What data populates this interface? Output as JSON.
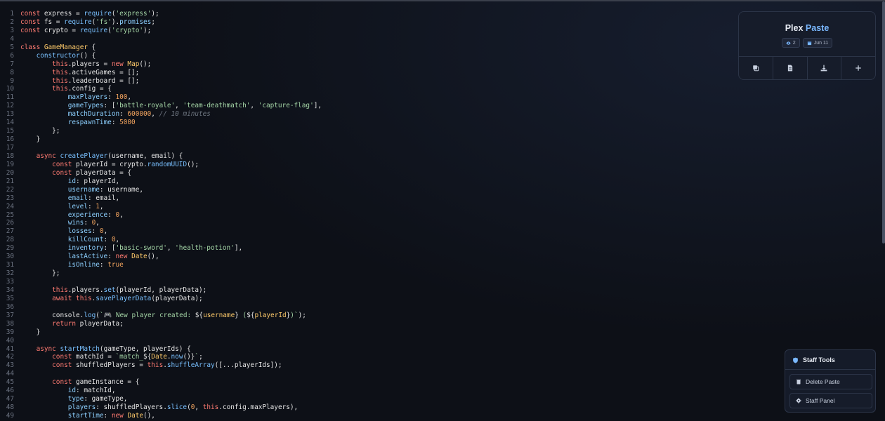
{
  "code_lines": [
    [
      [
        "k",
        "const"
      ],
      [
        "p",
        " express = "
      ],
      [
        "f",
        "require"
      ],
      [
        "p",
        "("
      ],
      [
        "s",
        "'express'"
      ],
      [
        "p",
        ");"
      ]
    ],
    [
      [
        "k",
        "const"
      ],
      [
        "p",
        " fs = "
      ],
      [
        "f",
        "require"
      ],
      [
        "p",
        "("
      ],
      [
        "s",
        "'fs'"
      ],
      [
        "p",
        ")."
      ],
      [
        "pr",
        "promises"
      ],
      [
        "p",
        ";"
      ]
    ],
    [
      [
        "k",
        "const"
      ],
      [
        "p",
        " crypto = "
      ],
      [
        "f",
        "require"
      ],
      [
        "p",
        "("
      ],
      [
        "s",
        "'crypto'"
      ],
      [
        "p",
        ");"
      ]
    ],
    [],
    [
      [
        "k",
        "class"
      ],
      [
        "p",
        " "
      ],
      [
        "cl",
        "GameManager"
      ],
      [
        "p",
        " {"
      ]
    ],
    [
      [
        "p",
        "    "
      ],
      [
        "f",
        "constructor"
      ],
      [
        "p",
        "() {"
      ]
    ],
    [
      [
        "p",
        "        "
      ],
      [
        "k",
        "this"
      ],
      [
        "p",
        ".players = "
      ],
      [
        "k",
        "new"
      ],
      [
        "p",
        " "
      ],
      [
        "cl",
        "Map"
      ],
      [
        "p",
        "();"
      ]
    ],
    [
      [
        "p",
        "        "
      ],
      [
        "k",
        "this"
      ],
      [
        "p",
        ".activeGames = [];"
      ]
    ],
    [
      [
        "p",
        "        "
      ],
      [
        "k",
        "this"
      ],
      [
        "p",
        ".leaderboard = [];"
      ]
    ],
    [
      [
        "p",
        "        "
      ],
      [
        "k",
        "this"
      ],
      [
        "p",
        ".config = {"
      ]
    ],
    [
      [
        "p",
        "            "
      ],
      [
        "pr",
        "maxPlayers"
      ],
      [
        "p",
        ": "
      ],
      [
        "n",
        "100"
      ],
      [
        "p",
        ","
      ]
    ],
    [
      [
        "p",
        "            "
      ],
      [
        "pr",
        "gameTypes"
      ],
      [
        "p",
        ": ["
      ],
      [
        "s",
        "'battle-royale'"
      ],
      [
        "p",
        ", "
      ],
      [
        "s",
        "'team-deathmatch'"
      ],
      [
        "p",
        ", "
      ],
      [
        "s",
        "'capture-flag'"
      ],
      [
        "p",
        "],"
      ]
    ],
    [
      [
        "p",
        "            "
      ],
      [
        "pr",
        "matchDuration"
      ],
      [
        "p",
        ": "
      ],
      [
        "n",
        "600000"
      ],
      [
        "p",
        ", "
      ],
      [
        "c",
        "// 10 minutes"
      ]
    ],
    [
      [
        "p",
        "            "
      ],
      [
        "pr",
        "respawnTime"
      ],
      [
        "p",
        ": "
      ],
      [
        "n",
        "5000"
      ]
    ],
    [
      [
        "p",
        "        };"
      ]
    ],
    [
      [
        "p",
        "    }"
      ]
    ],
    [],
    [
      [
        "p",
        "    "
      ],
      [
        "k",
        "async"
      ],
      [
        "p",
        " "
      ],
      [
        "f",
        "createPlayer"
      ],
      [
        "p",
        "(username, email) {"
      ]
    ],
    [
      [
        "p",
        "        "
      ],
      [
        "k",
        "const"
      ],
      [
        "p",
        " playerId = crypto."
      ],
      [
        "f",
        "randomUUID"
      ],
      [
        "p",
        "();"
      ]
    ],
    [
      [
        "p",
        "        "
      ],
      [
        "k",
        "const"
      ],
      [
        "p",
        " playerData = {"
      ]
    ],
    [
      [
        "p",
        "            "
      ],
      [
        "pr",
        "id"
      ],
      [
        "p",
        ": playerId,"
      ]
    ],
    [
      [
        "p",
        "            "
      ],
      [
        "pr",
        "username"
      ],
      [
        "p",
        ": username,"
      ]
    ],
    [
      [
        "p",
        "            "
      ],
      [
        "pr",
        "email"
      ],
      [
        "p",
        ": email,"
      ]
    ],
    [
      [
        "p",
        "            "
      ],
      [
        "pr",
        "level"
      ],
      [
        "p",
        ": "
      ],
      [
        "n",
        "1"
      ],
      [
        "p",
        ","
      ]
    ],
    [
      [
        "p",
        "            "
      ],
      [
        "pr",
        "experience"
      ],
      [
        "p",
        ": "
      ],
      [
        "n",
        "0"
      ],
      [
        "p",
        ","
      ]
    ],
    [
      [
        "p",
        "            "
      ],
      [
        "pr",
        "wins"
      ],
      [
        "p",
        ": "
      ],
      [
        "n",
        "0"
      ],
      [
        "p",
        ","
      ]
    ],
    [
      [
        "p",
        "            "
      ],
      [
        "pr",
        "losses"
      ],
      [
        "p",
        ": "
      ],
      [
        "n",
        "0"
      ],
      [
        "p",
        ","
      ]
    ],
    [
      [
        "p",
        "            "
      ],
      [
        "pr",
        "killCount"
      ],
      [
        "p",
        ": "
      ],
      [
        "n",
        "0"
      ],
      [
        "p",
        ","
      ]
    ],
    [
      [
        "p",
        "            "
      ],
      [
        "pr",
        "inventory"
      ],
      [
        "p",
        ": ["
      ],
      [
        "s",
        "'basic-sword'"
      ],
      [
        "p",
        ", "
      ],
      [
        "s",
        "'health-potion'"
      ],
      [
        "p",
        "],"
      ]
    ],
    [
      [
        "p",
        "            "
      ],
      [
        "pr",
        "lastActive"
      ],
      [
        "p",
        ": "
      ],
      [
        "k",
        "new"
      ],
      [
        "p",
        " "
      ],
      [
        "cl",
        "Date"
      ],
      [
        "p",
        "(),"
      ]
    ],
    [
      [
        "p",
        "            "
      ],
      [
        "pr",
        "isOnline"
      ],
      [
        "p",
        ": "
      ],
      [
        "n",
        "true"
      ]
    ],
    [
      [
        "p",
        "        };"
      ]
    ],
    [],
    [
      [
        "p",
        "        "
      ],
      [
        "k",
        "this"
      ],
      [
        "p",
        ".players."
      ],
      [
        "f",
        "set"
      ],
      [
        "p",
        "(playerId, playerData);"
      ]
    ],
    [
      [
        "p",
        "        "
      ],
      [
        "k",
        "await"
      ],
      [
        "p",
        " "
      ],
      [
        "k",
        "this"
      ],
      [
        "p",
        "."
      ],
      [
        "f",
        "savePlayerData"
      ],
      [
        "p",
        "(playerData);"
      ]
    ],
    [],
    [
      [
        "p",
        "        console."
      ],
      [
        "f",
        "log"
      ],
      [
        "p",
        "("
      ],
      [
        "s",
        "`🎮 New player created: "
      ],
      [
        "p",
        "${"
      ],
      [
        "cl",
        "username"
      ],
      [
        "p",
        "}"
      ],
      [
        "s",
        " ("
      ],
      [
        "p",
        "${"
      ],
      [
        "cl",
        "playerId"
      ],
      [
        "p",
        "}"
      ],
      [
        "s",
        ")`"
      ],
      [
        "p",
        ");"
      ]
    ],
    [
      [
        "p",
        "        "
      ],
      [
        "k",
        "return"
      ],
      [
        "p",
        " playerData;"
      ]
    ],
    [
      [
        "p",
        "    }"
      ]
    ],
    [],
    [
      [
        "p",
        "    "
      ],
      [
        "k",
        "async"
      ],
      [
        "p",
        " "
      ],
      [
        "f",
        "startMatch"
      ],
      [
        "p",
        "(gameType, playerIds) {"
      ]
    ],
    [
      [
        "p",
        "        "
      ],
      [
        "k",
        "const"
      ],
      [
        "p",
        " matchId = "
      ],
      [
        "s",
        "`match_"
      ],
      [
        "p",
        "${"
      ],
      [
        "cl",
        "Date"
      ],
      [
        "p",
        "."
      ],
      [
        "f",
        "now"
      ],
      [
        "p",
        "()}"
      ],
      [
        "s",
        "`"
      ],
      [
        "p",
        ";"
      ]
    ],
    [
      [
        "p",
        "        "
      ],
      [
        "k",
        "const"
      ],
      [
        "p",
        " shuffledPlayers = "
      ],
      [
        "k",
        "this"
      ],
      [
        "p",
        "."
      ],
      [
        "f",
        "shuffleArray"
      ],
      [
        "p",
        "([...playerIds]);"
      ]
    ],
    [],
    [
      [
        "p",
        "        "
      ],
      [
        "k",
        "const"
      ],
      [
        "p",
        " gameInstance = {"
      ]
    ],
    [
      [
        "p",
        "            "
      ],
      [
        "pr",
        "id"
      ],
      [
        "p",
        ": matchId,"
      ]
    ],
    [
      [
        "p",
        "            "
      ],
      [
        "pr",
        "type"
      ],
      [
        "p",
        ": gameType,"
      ]
    ],
    [
      [
        "p",
        "            "
      ],
      [
        "pr",
        "players"
      ],
      [
        "p",
        ": shuffledPlayers."
      ],
      [
        "f",
        "slice"
      ],
      [
        "p",
        "("
      ],
      [
        "n",
        "0"
      ],
      [
        "p",
        ", "
      ],
      [
        "k",
        "this"
      ],
      [
        "p",
        ".config.maxPlayers),"
      ]
    ],
    [
      [
        "p",
        "            "
      ],
      [
        "pr",
        "startTime"
      ],
      [
        "p",
        ": "
      ],
      [
        "k",
        "new"
      ],
      [
        "p",
        " "
      ],
      [
        "cl",
        "Date"
      ],
      [
        "p",
        "(),"
      ]
    ]
  ],
  "paste": {
    "title_main": "Plex",
    "title_accent": "Paste",
    "views": "2",
    "date": "Jun 11"
  },
  "staff": {
    "title": "Staff Tools",
    "delete_label": "Delete Paste",
    "panel_label": "Staff Panel"
  },
  "colors": {
    "accent": "#7ab8ff",
    "keyword": "#ff7b72",
    "string": "#a5d6a7",
    "function": "#79c0ff",
    "number": "#f0a35e"
  },
  "icons": [
    "eye-icon",
    "calendar-icon",
    "copy-icon",
    "document-icon",
    "download-icon",
    "plus-icon",
    "shield-icon",
    "trash-icon",
    "gear-icon"
  ]
}
